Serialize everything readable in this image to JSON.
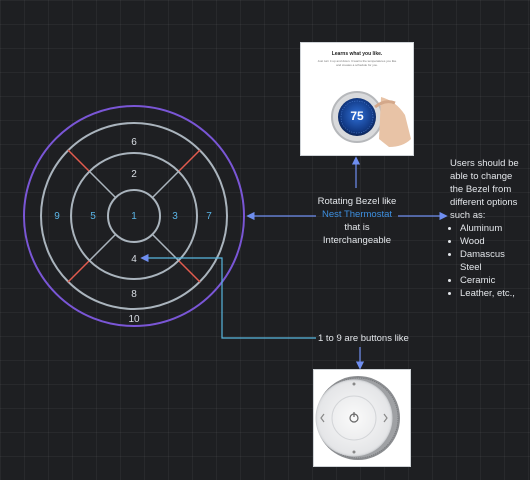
{
  "dial": {
    "segments": [
      "6",
      "2",
      "9",
      "5",
      "1",
      "3",
      "7",
      "4",
      "8",
      "10"
    ]
  },
  "notes": {
    "bezel_line1": "Rotating Bezel like",
    "bezel_link": "Nest Thermostat",
    "bezel_line3": "that is",
    "bezel_line4": "Interchangeable",
    "options_intro": "Users should be able to change the Bezel from different options such as:",
    "options": [
      "Aluminum",
      "Wood",
      "Damascus Steel",
      "Ceramic",
      "Leather, etc.,"
    ],
    "buttons_note": "1 to 9 are buttons like"
  },
  "nest_photo": {
    "heading": "Learns what you like.",
    "body": "Just turn it up and down. It learns the temperatures you like and creates a schedule for you.",
    "temperature": "75"
  }
}
